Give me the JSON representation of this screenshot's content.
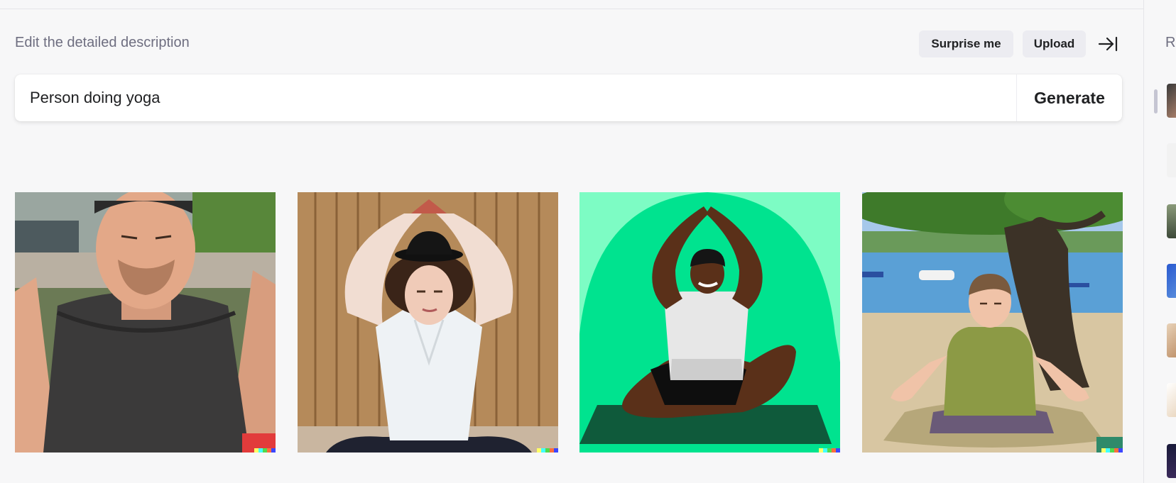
{
  "header": {
    "subtitle": "Edit the detailed description",
    "surprise_label": "Surprise me",
    "upload_label": "Upload"
  },
  "prompt": {
    "value": "Person doing yoga",
    "generate_label": "Generate"
  },
  "results": [
    {
      "name": "yoga-result-1"
    },
    {
      "name": "yoga-result-2"
    },
    {
      "name": "yoga-result-3"
    },
    {
      "name": "yoga-result-4"
    }
  ],
  "sidebar": {
    "title": "R"
  },
  "colors": {
    "background": "#f7f7f8",
    "button_bg": "#ececf1",
    "text": "#202123",
    "muted": "#6e6e80"
  }
}
